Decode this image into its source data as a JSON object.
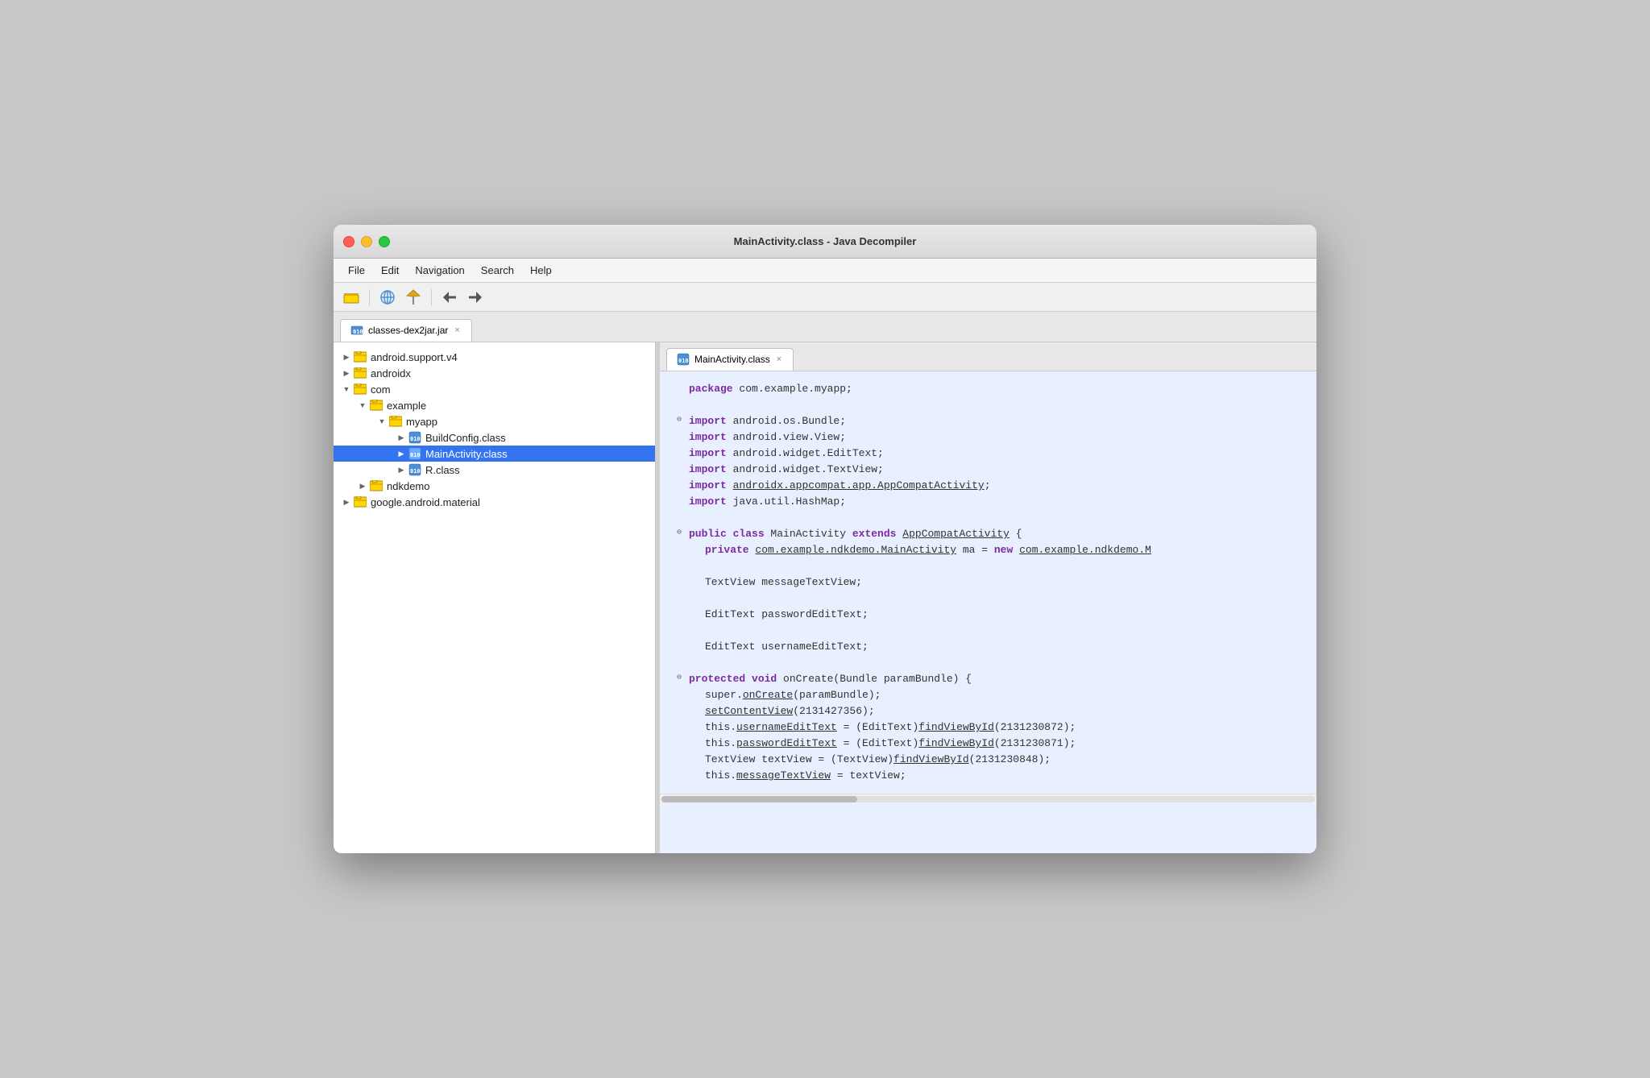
{
  "window": {
    "title": "MainActivity.class - Java Decompiler"
  },
  "menu": {
    "items": [
      "File",
      "Edit",
      "Navigation",
      "Search",
      "Help"
    ]
  },
  "toolbar": {
    "buttons": [
      {
        "name": "open-icon",
        "symbol": "📁"
      },
      {
        "name": "globe-icon",
        "symbol": "🌐"
      },
      {
        "name": "pin-icon",
        "symbol": "📌"
      },
      {
        "name": "back-icon",
        "symbol": "←"
      },
      {
        "name": "forward-icon",
        "symbol": "→"
      }
    ]
  },
  "tabs": {
    "main_tab": {
      "label": "classes-dex2jar.jar",
      "close": "×"
    }
  },
  "file_tree": {
    "items": [
      {
        "level": 0,
        "indent": 0,
        "expanded": true,
        "type": "pkg",
        "label": "android.support.v4"
      },
      {
        "level": 0,
        "indent": 0,
        "expanded": true,
        "type": "pkg",
        "label": "androidx"
      },
      {
        "level": 0,
        "indent": 0,
        "expanded": true,
        "type": "pkg",
        "label": "com"
      },
      {
        "level": 1,
        "indent": 1,
        "expanded": true,
        "type": "pkg",
        "label": "example"
      },
      {
        "level": 2,
        "indent": 2,
        "expanded": true,
        "type": "pkg",
        "label": "myapp"
      },
      {
        "level": 3,
        "indent": 3,
        "expanded": false,
        "type": "class",
        "label": "BuildConfig.class",
        "selected": false
      },
      {
        "level": 3,
        "indent": 3,
        "expanded": false,
        "type": "class",
        "label": "MainActivity.class",
        "selected": true
      },
      {
        "level": 3,
        "indent": 3,
        "expanded": false,
        "type": "class",
        "label": "R.class",
        "selected": false
      },
      {
        "level": 1,
        "indent": 1,
        "expanded": false,
        "type": "pkg",
        "label": "ndkdemo"
      },
      {
        "level": 0,
        "indent": 0,
        "expanded": false,
        "type": "pkg",
        "label": "google.android.material"
      }
    ]
  },
  "code_tab": {
    "label": "MainActivity.class",
    "close": "×"
  },
  "code": {
    "lines": [
      {
        "fold": "none",
        "content": "<span class='kw'>package</span> <span class='plain'> com.example.myapp;</span>"
      },
      {
        "fold": "none",
        "content": ""
      },
      {
        "fold": "open",
        "content": "<span class='kw'>import</span> <span class='plain'> android.os.Bundle;</span>"
      },
      {
        "fold": "none",
        "content": "<span class='kw'>import</span> <span class='plain'> android.view.View;</span>"
      },
      {
        "fold": "none",
        "content": "<span class='kw'>import</span> <span class='plain'> android.widget.EditText;</span>"
      },
      {
        "fold": "none",
        "content": "<span class='kw'>import</span> <span class='plain'> android.widget.TextView;</span>"
      },
      {
        "fold": "none",
        "content": "<span class='kw'>import</span> <span class='link'> androidx.appcompat.app.AppCompatActivity</span><span class='plain'>;</span>"
      },
      {
        "fold": "none",
        "content": "<span class='kw'>import</span> <span class='plain'> java.util.HashMap;</span>"
      },
      {
        "fold": "none",
        "content": ""
      },
      {
        "fold": "open",
        "content": "<span class='kw'>public class</span> <span class='plain'> MainActivity </span><span class='kw'>extends</span> <span class='link'> AppCompatActivity</span> <span class='plain'>{ </span>"
      },
      {
        "fold": "none",
        "indent": 1,
        "content": "<span class='kw'>private</span> <span class='link'> com.example.ndkdemo.MainActivity</span><span class='plain'> ma = </span><span class='kw'>new</span> <span class='link'> com.example.ndkdemo.M</span>"
      },
      {
        "fold": "none",
        "content": ""
      },
      {
        "fold": "none",
        "indent": 1,
        "content": "<span class='plain'> TextView messageTextView;</span>"
      },
      {
        "fold": "none",
        "content": ""
      },
      {
        "fold": "none",
        "indent": 1,
        "content": "<span class='plain'> EditText passwordEditText;</span>"
      },
      {
        "fold": "none",
        "content": ""
      },
      {
        "fold": "none",
        "indent": 1,
        "content": "<span class='plain'> EditText usernameEditText;</span>"
      },
      {
        "fold": "none",
        "content": ""
      },
      {
        "fold": "open",
        "content": "<span class='kw'>protected void</span> <span class='plain'> onCreate(Bundle paramBundle) {</span>"
      },
      {
        "fold": "none",
        "indent": 1,
        "content": "<span class='plain'> super.</span><span class='link'>onCreate</span><span class='plain'>(paramBundle);</span>"
      },
      {
        "fold": "none",
        "indent": 1,
        "content": "<span class='link'> setContentView</span><span class='plain'>(2131427356);</span>"
      },
      {
        "fold": "none",
        "indent": 1,
        "content": "<span class='plain'> this.</span><span class='link'>usernameEditText</span><span class='plain'> = (EditText)</span><span class='link'>findViewById</span><span class='plain'>(2131230872);</span>"
      },
      {
        "fold": "none",
        "indent": 1,
        "content": "<span class='plain'> this.</span><span class='link'>passwordEditText</span><span class='plain'> = (EditText)</span><span class='link'>findViewById</span><span class='plain'>(2131230871);</span>"
      },
      {
        "fold": "none",
        "indent": 1,
        "content": "<span class='plain'> TextView textView = (TextView)</span><span class='link'>findViewById</span><span class='plain'>(2131230848);</span>"
      },
      {
        "fold": "none",
        "indent": 1,
        "content": "<span class='plain'> this.</span><span class='link'>messageTextView</span><span class='plain'> = textView;</span>"
      }
    ]
  }
}
